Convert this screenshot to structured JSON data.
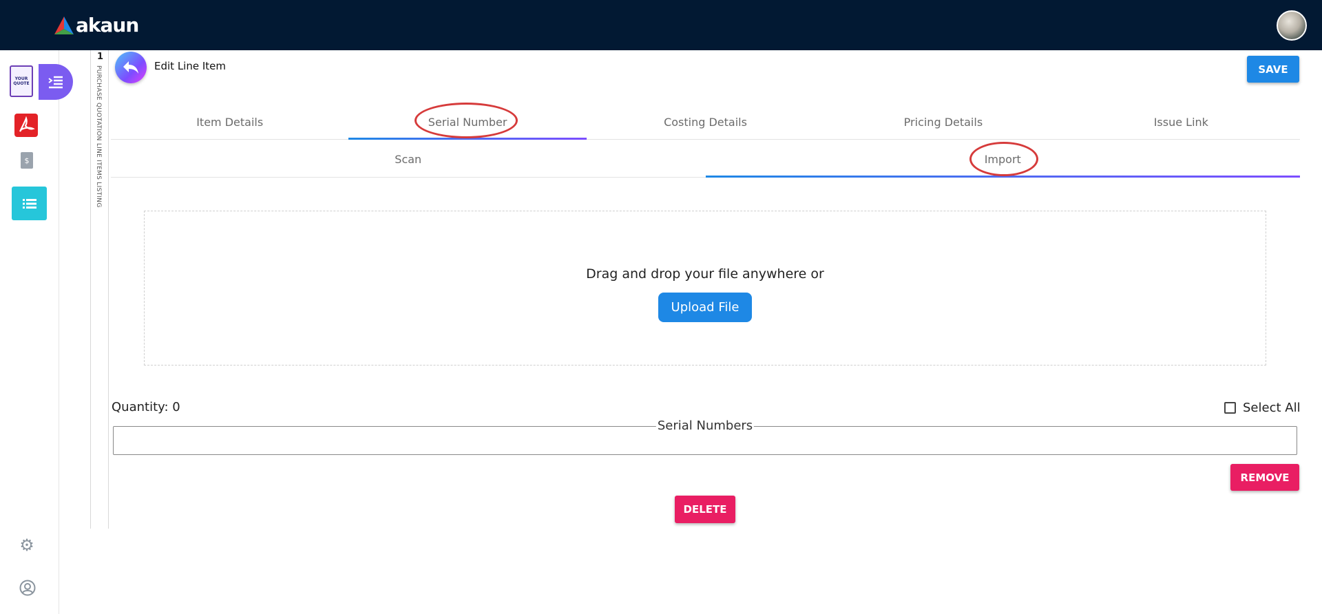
{
  "app": {
    "logo_text": "akaun"
  },
  "rail": {
    "number": "1",
    "label": "PURCHASE QUOTATION LINE ITEMS LISTING"
  },
  "header": {
    "title": "Edit Line Item",
    "save_label": "SAVE"
  },
  "tabs": [
    {
      "label": "Item Details"
    },
    {
      "label": "Serial Number"
    },
    {
      "label": "Costing Details"
    },
    {
      "label": "Pricing Details"
    },
    {
      "label": "Issue Link"
    }
  ],
  "subtabs": [
    {
      "label": "Scan"
    },
    {
      "label": "Import"
    }
  ],
  "upload": {
    "prompt": "Drag and drop your file anywhere or",
    "button_label": "Upload File"
  },
  "quantity_label": "Quantity: 0",
  "select_all_label": "Select All",
  "serial_numbers_label": "Serial Numbers",
  "remove_label": "REMOVE",
  "delete_label": "DELETE",
  "quote_thumb_text": "YOUR QUOTE",
  "colors": {
    "topbar": "#021933",
    "accent": "#1e88e5",
    "danger": "#e91e63",
    "annotation": "#d63b3b"
  }
}
